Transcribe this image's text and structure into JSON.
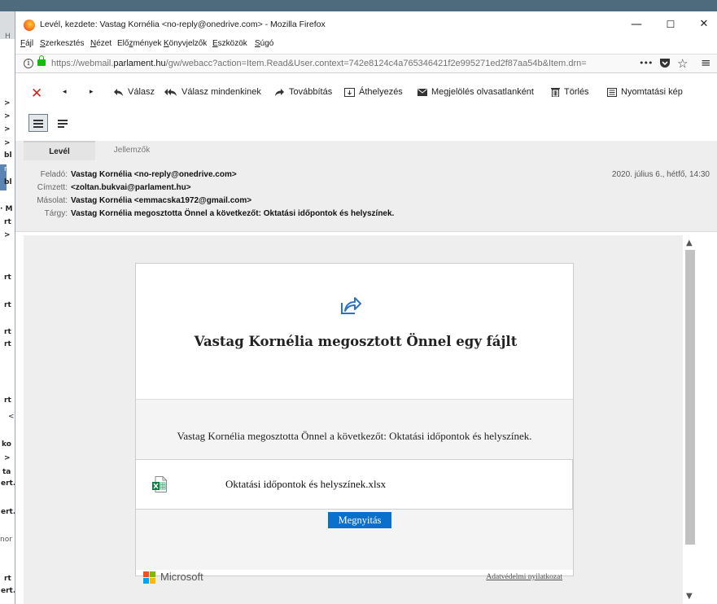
{
  "window": {
    "title": "Levél, kezdete: Vastag Kornélia <no-reply@onedrive.com> - Mozilla Firefox",
    "minimize": "—",
    "maximize": "☐",
    "close": "✕"
  },
  "menu": {
    "file": {
      "pre": "",
      "ul": "F",
      "post": "ájl"
    },
    "edit": {
      "pre": "",
      "ul": "S",
      "post": "zerkesztés"
    },
    "view": {
      "pre": "",
      "ul": "N",
      "post": "ézet"
    },
    "history": {
      "pre": "Elő",
      "ul": "z",
      "post": "mények"
    },
    "bookmarks": {
      "pre": "",
      "ul": "K",
      "post": "önyvjelzők"
    },
    "tools": {
      "pre": "",
      "ul": "E",
      "post": "szközök"
    },
    "help": {
      "pre": "",
      "ul": "S",
      "post": "úgó"
    }
  },
  "urlbar": {
    "prefix": "https://webmail.",
    "domain": "parlament.hu",
    "rest": "/gw/webacc?action=Item.Read&User.context=742e8124c4a765346421f2e995271ed2f87aa54b&Item.drn=",
    "more_icon": "•••",
    "pocket_icon": "pocket-icon",
    "star_icon": "☆",
    "menu_icon": "≡"
  },
  "toolbar": {
    "delete_x": "✕",
    "back_arrow": "◂",
    "forward_arrow": "▸",
    "reply": "Válasz",
    "reply_all": "Válasz mindenkinek",
    "forward": "Továbbítás",
    "move": "Áthelyezés",
    "mark_unread_pre": "Meg",
    "mark_unread_ul": "j",
    "mark_unread_post": "elölés olvasatlanként",
    "delete": "Törlés",
    "print": "Nyomtatási kép"
  },
  "tabs": {
    "message": "Levél",
    "properties": "Jellemzők"
  },
  "headers": {
    "from_label": "Feladó:",
    "from_value": "Vastag Kornélia <no-reply@onedrive.com>",
    "to_label": "Címzett:",
    "to_value": "<zoltan.bukvai@parlament.hu>",
    "cc_label": "Másolat:",
    "cc_value": "Vastag Kornélia <emmacska1972@gmail.com>",
    "subject_label": "Tárgy:",
    "subject_value": "Vastag Kornélia megosztotta Önnel a következőt: Oktatási időpontok és helyszínek.",
    "date": "2020. július 6., hétfő, 14:30"
  },
  "email": {
    "title": "Vastag Kornélia megosztott Önnel egy fájlt",
    "description": "Vastag Kornélia megosztotta Önnel a következőt: Oktatási időpontok és helyszínek.",
    "file_name": "Oktatási időpontok és helyszínek.xlsx",
    "open_button": "Megnyitás",
    "brand": "Microsoft",
    "privacy": "Adatvédelmi nyilatkozat"
  },
  "background_window": {
    "fragments": [
      "H",
      ">",
      ">",
      ">",
      ">",
      "bl",
      "re",
      "bl",
      "· M",
      "rt",
      ">",
      "rt",
      "rt",
      "rt",
      "rt",
      "rt",
      "<",
      "ko",
      ">",
      "ta",
      "ert.",
      "ert.",
      "nor",
      "rt",
      "ert."
    ]
  },
  "colors": {
    "accent": "#0b6fce",
    "delete_red": "#d0241b",
    "lock_green": "#12bc00"
  }
}
